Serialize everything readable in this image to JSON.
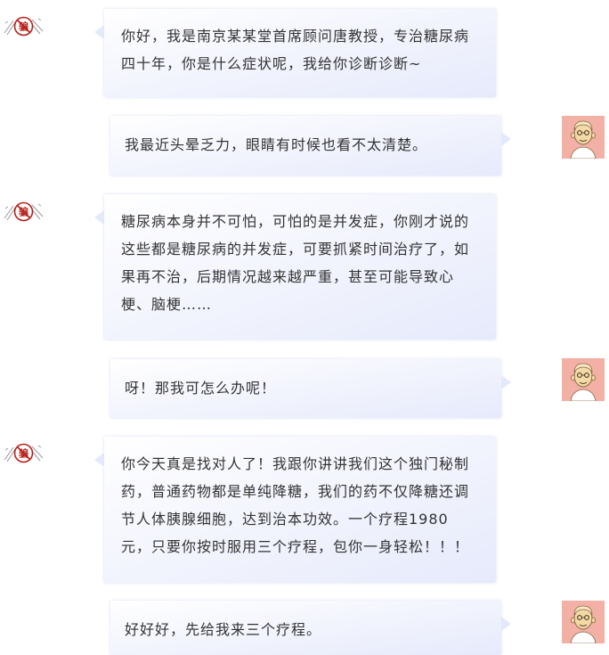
{
  "conversation": {
    "messages": [
      {
        "sender": "quack-doctor",
        "side": "left",
        "text": "你好，我是南京某某堂首席顾问唐教授，专治糖尿病\n四十年，你是什么症状呢，我给你诊断诊断~"
      },
      {
        "sender": "patient",
        "side": "right",
        "text": "我最近头晕乏力，眼睛有时候也看不太清楚。"
      },
      {
        "sender": "quack-doctor",
        "side": "left",
        "text": "糖尿病本身并不可怕，可怕的是并发症，你刚才说的\n这些都是糖尿病的并发症，可要抓紧时间治疗了，如\n果再不治，后期情况越来越严重，甚至可能导致心\n梗、脑梗……"
      },
      {
        "sender": "patient",
        "side": "right",
        "text": "呀！那我可怎么办呢！"
      },
      {
        "sender": "quack-doctor",
        "side": "left",
        "text": "你今天真是找对人了！我跟你讲讲我们这个独门秘制\n药，普通药物都是单纯降糖，我们的药不仅降糖还调\n节人体胰腺细胞，达到治本功效。一个疗程1980\n元，只要你按时服用三个疗程，包你一身轻松！！！"
      },
      {
        "sender": "patient",
        "side": "right",
        "text": "好好好，先给我来三个疗程。"
      }
    ]
  },
  "avatars": {
    "quack_stamp_text": "骗",
    "quack_icon": "no-scam-stamp-icon",
    "patient_icon": "elderly-man-avatar-icon"
  },
  "colors": {
    "bubble_gradient_start": "#ffffff",
    "bubble_gradient_end": "#e6eafb",
    "patient_avatar_bg": "#f3b0a5",
    "stamp_red": "#b5201a",
    "text": "#333333"
  }
}
